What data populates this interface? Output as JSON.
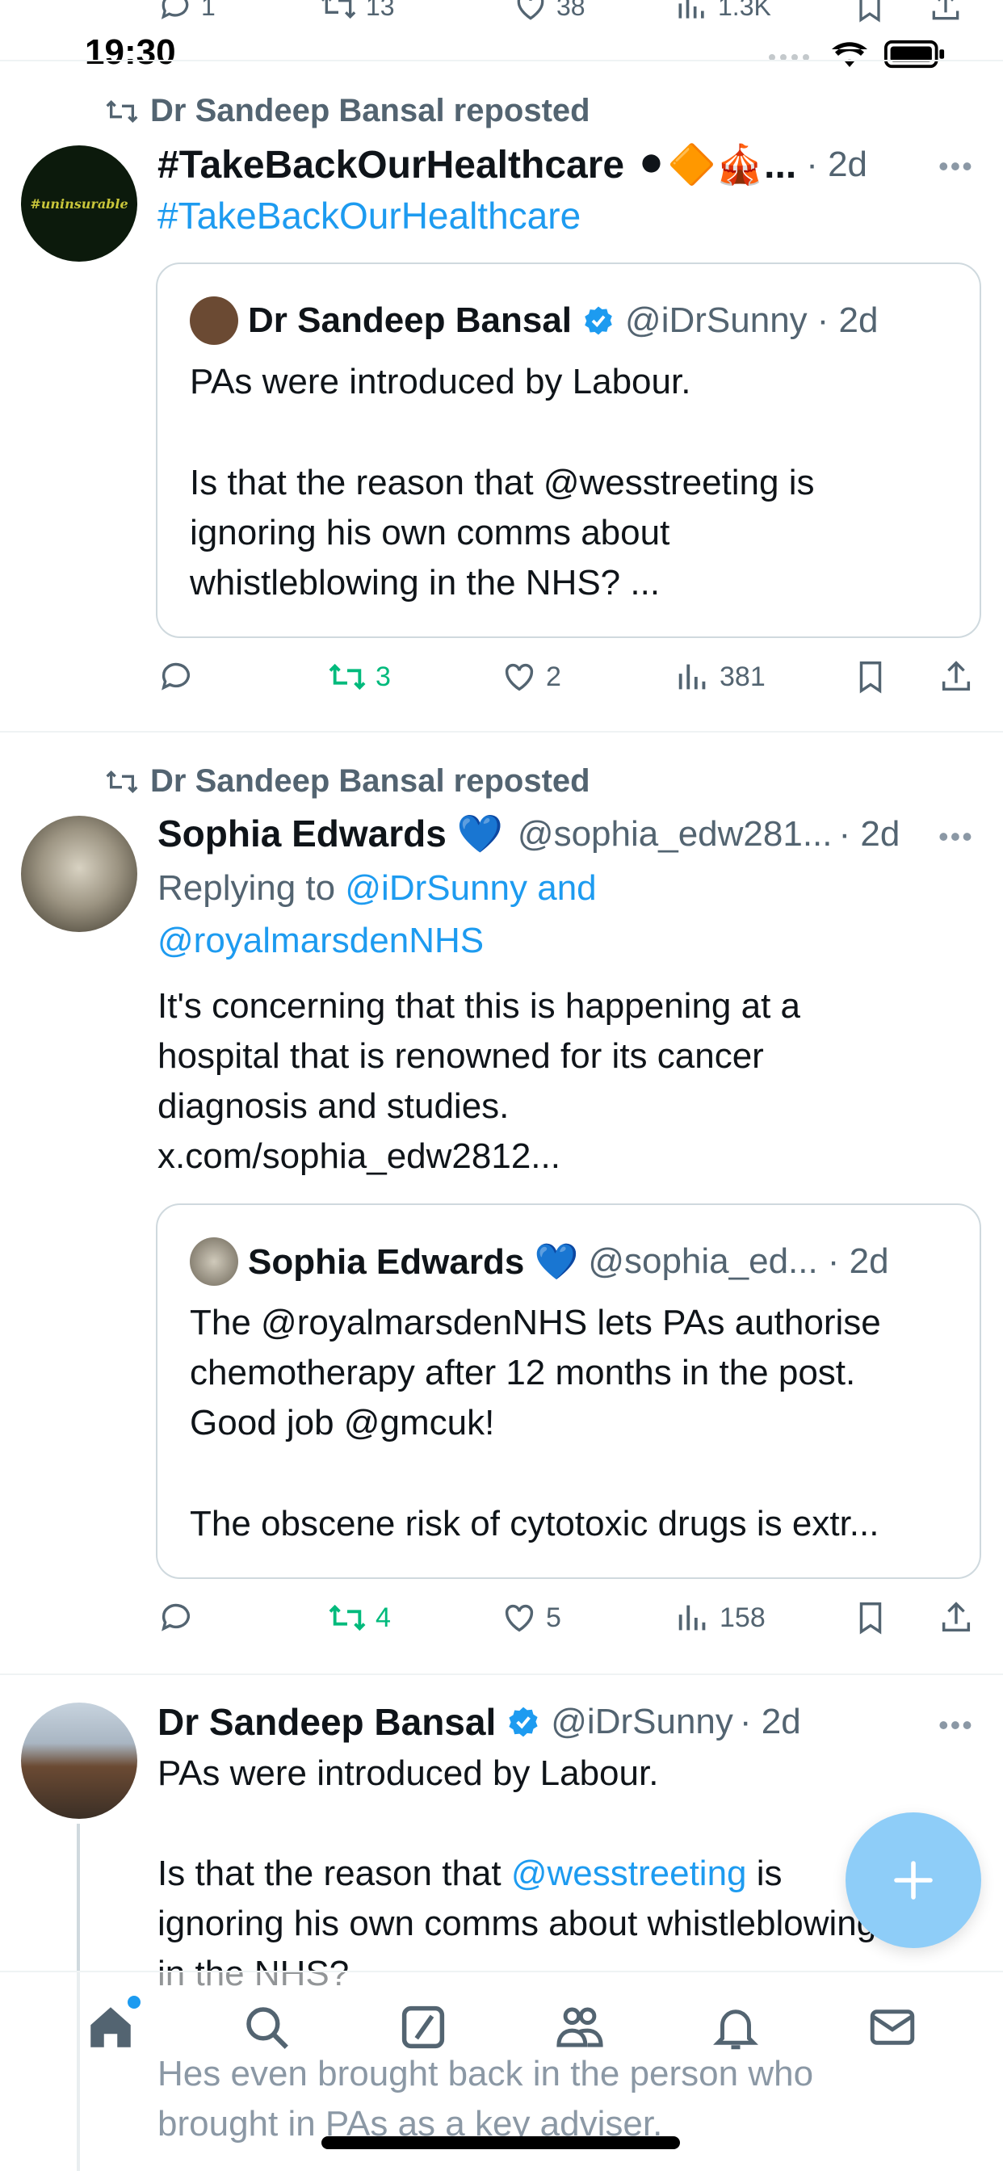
{
  "top_partial_actions": {
    "replies": "1",
    "reposts": "13",
    "likes": "38",
    "views": "1.3K"
  },
  "status_bar": {
    "time": "19:30"
  },
  "post1": {
    "reposted_by": "Dr Sandeep Bansal reposted",
    "avatar_text": "#uninsurable",
    "display_name": "#TakeBackOurHealthcare ⚫🔶🎪...",
    "time": "· 2d",
    "hashtag": "#TakeBackOurHealthcare",
    "quote": {
      "name": "Dr Sandeep Bansal",
      "handle": "@iDrSunny",
      "time": "· 2d",
      "line1": "PAs were introduced by Labour.",
      "line2": "Is that the reason that @wesstreeting is",
      "line3": "ignoring his own comms about",
      "line4": "whistleblowing in the NHS? ..."
    },
    "actions": {
      "reposts": "3",
      "likes": "2",
      "views": "381"
    }
  },
  "post2": {
    "reposted_by": "Dr Sandeep Bansal reposted",
    "display_name": "Sophia Edwards 💙",
    "handle": "@sophia_edw281...",
    "time": "· 2d",
    "replying_prefix": "Replying to",
    "replying_to_1": "@iDrSunny and",
    "replying_to_2": "@royalmarsdenNHS",
    "line1": "It's concerning that this is happening at a",
    "line2": "hospital that is renowned for its cancer",
    "line3": "diagnosis and studies.",
    "url": "x.com/sophia_edw2812...",
    "quote": {
      "name": "Sophia Edwards 💙",
      "handle": "@sophia_ed...",
      "time": "· 2d",
      "line1": "The @royalmarsdenNHS lets PAs authorise",
      "line2": "chemotherapy after 12 months in the post.",
      "line3": "Good job @gmcuk!",
      "line4": "The obscene risk of cytotoxic drugs is extr..."
    },
    "actions": {
      "reposts": "4",
      "likes": "5",
      "views": "158"
    }
  },
  "post3": {
    "display_name": "Dr Sandeep Bansal",
    "handle": "@iDrSunny",
    "time": "· 2d",
    "line1": "PAs were introduced by Labour.",
    "line2_pre": "Is that the reason that",
    "line2_mention": "@wesstreeting",
    "line2_post": "is",
    "line3": "ignoring his own comms about whistleblowing",
    "line4": "in the NHS?",
    "line5": "Hes even brought back in the person who",
    "line6": "brought in PAs as a key adviser."
  },
  "colors": {
    "accent": "#1d9bf0",
    "repost_green": "#00ba7c",
    "muted": "#536471",
    "fab": "#8ecdf8"
  },
  "icons": [
    "reply-icon",
    "repost-icon",
    "like-icon",
    "views-icon",
    "bookmark-icon",
    "share-icon",
    "verified-icon",
    "home-icon",
    "search-icon",
    "grok-icon",
    "communities-icon",
    "notifications-icon",
    "messages-icon",
    "compose-icon"
  ]
}
